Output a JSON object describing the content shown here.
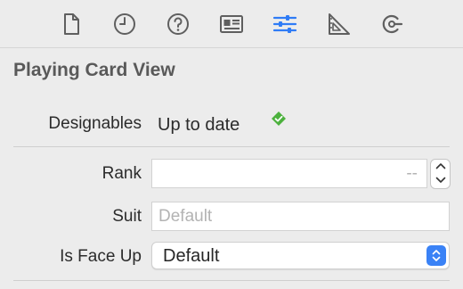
{
  "toolbar": {
    "tabs": [
      {
        "name": "file-icon"
      },
      {
        "name": "history-icon"
      },
      {
        "name": "help-icon"
      },
      {
        "name": "identity-card-icon"
      },
      {
        "name": "attributes-sliders-icon"
      },
      {
        "name": "size-ruler-icon"
      },
      {
        "name": "connections-icon"
      }
    ],
    "selected_index": 4,
    "accent_color": "#2f7cf6",
    "icon_color": "#5f5f5f"
  },
  "section": {
    "title": "Playing Card View"
  },
  "designables": {
    "label": "Designables",
    "value": "Up to date",
    "status_color": "#4cb13d"
  },
  "rank": {
    "label": "Rank",
    "value": "",
    "placeholder": "--"
  },
  "suit": {
    "label": "Suit",
    "value": "",
    "placeholder": "Default"
  },
  "is_face_up": {
    "label": "Is Face Up",
    "selected": "Default"
  }
}
